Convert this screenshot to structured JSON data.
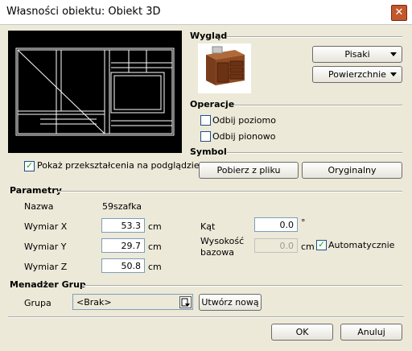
{
  "window": {
    "title": "Własności obiektu: Obiekt 3D",
    "close_glyph": "✕"
  },
  "preview": {
    "checkbox_label": "Pokaż przekształcenia na podglądzie",
    "checked": true
  },
  "appearance": {
    "heading": "Wygląd",
    "pens_label": "Pisaki",
    "surfaces_label": "Powierzchnie"
  },
  "operations": {
    "heading": "Operacje",
    "mirror_h_label": "Odbij poziomo",
    "mirror_v_label": "Odbij pionowo"
  },
  "symbol": {
    "heading": "Symbol",
    "from_file_label": "Pobierz z pliku",
    "original_label": "Oryginalny"
  },
  "params": {
    "heading": "Parametry",
    "name_label": "Nazwa",
    "name_value": "59szafka",
    "dim_x_label": "Wymiar X",
    "dim_x_value": "53.3",
    "dim_y_label": "Wymiar Y",
    "dim_y_value": "29.7",
    "dim_z_label": "Wymiar Z",
    "dim_z_value": "50.8",
    "unit": "cm",
    "angle_label": "Kąt",
    "angle_value": "0.0",
    "angle_unit": "°",
    "base_height_label_1": "Wysokość",
    "base_height_label_2": "bazowa",
    "base_height_value": "0.0",
    "auto_label": "Automatycznie",
    "auto_checked": true
  },
  "groups": {
    "heading": "Menadżer Grup",
    "group_label": "Grupa",
    "group_value": "<Brak>",
    "create_label": "Utwórz nową"
  },
  "footer": {
    "ok_label": "OK",
    "cancel_label": "Anuluj"
  }
}
